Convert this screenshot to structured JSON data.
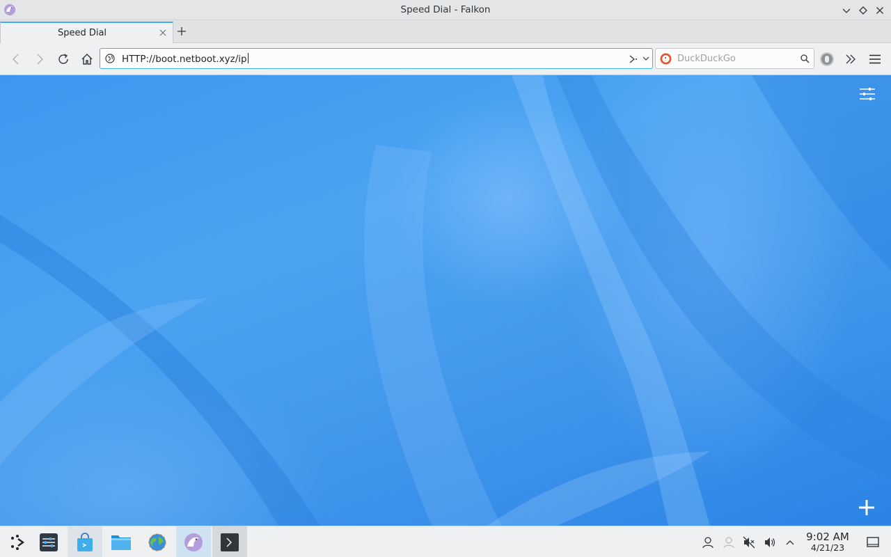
{
  "window": {
    "title": "Speed Dial - Falkon",
    "controls": [
      "minimize",
      "maximize",
      "close"
    ]
  },
  "tabs": [
    {
      "title": "Speed Dial",
      "active": true
    }
  ],
  "navbar": {
    "url": "HTTP://boot.netboot.xyz/ip",
    "search_placeholder": "DuckDuckGo",
    "search_engine": "DuckDuckGo"
  },
  "content": {
    "page": "Speed Dial",
    "background_color": "#3d97ef"
  },
  "taskbar": {
    "items": [
      "application-launcher",
      "system-settings",
      "discover",
      "dolphin",
      "web-browser",
      "falkon",
      "konsole"
    ],
    "tray": [
      "user-switcher",
      "network",
      "audio-muted",
      "volume",
      "show-hidden"
    ],
    "clock": {
      "time": "9:02 AM",
      "date": "4/21/23"
    }
  },
  "colors": {
    "accent": "#3daee9",
    "panel": "#eff0f1"
  }
}
